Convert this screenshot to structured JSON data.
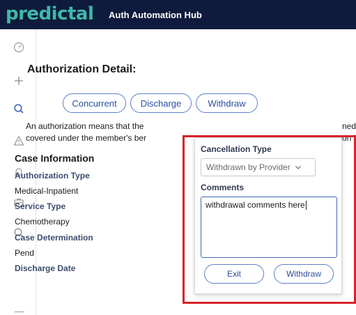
{
  "header": {
    "brand": "predictal",
    "brand_mark": "™",
    "app_title": "Auth Automation Hub"
  },
  "sidebar": {
    "icons": [
      "dashboard-icon",
      "plus-icon",
      "search-icon",
      "warning-icon",
      "bell-icon",
      "briefcase-icon",
      "search-icon"
    ]
  },
  "main": {
    "title": "Authorization Detail:",
    "chips": [
      "Concurrent",
      "Discharge",
      "Withdraw"
    ],
    "description_line1": "An authorization means that the",
    "description_line2": "covered under the member's ber",
    "description_right1": "ned",
    "description_right2": "on b",
    "case": {
      "heading": "Case Information",
      "fields": [
        {
          "label": "Authorization Type",
          "value": "Medical-Inpatient"
        },
        {
          "label": "Service Type",
          "value": "Chemotherapy"
        },
        {
          "label": "Case Determination",
          "value": "Pend"
        },
        {
          "label": "Discharge Date",
          "value": ""
        }
      ]
    }
  },
  "popup": {
    "cancel_label": "Cancellation Type",
    "cancel_value": "Withdrawn by Provider",
    "comments_label": "Comments",
    "comments_value": "withdrawal comments here",
    "exit_label": "Exit",
    "withdraw_label": "Withdraw"
  },
  "colors": {
    "topbar": "#0f1b3d",
    "brand": "#3fb8a8",
    "accent": "#2b4fa0",
    "highlight": "#d9222a"
  }
}
